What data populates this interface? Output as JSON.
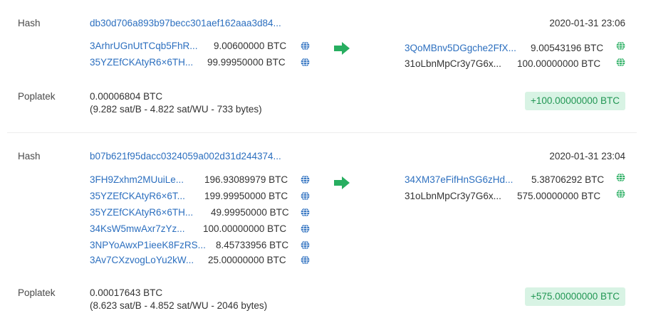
{
  "labels": {
    "hash": "Hash",
    "fee": "Poplatek"
  },
  "colors": {
    "link": "#2c6fbf",
    "green": "#219653",
    "badge_bg": "#d8f3e4",
    "globe_blue": "#2c6fbf",
    "globe_green": "#27ae60"
  },
  "transactions": [
    {
      "hash": "db30d706a893b97becc301aef162aaa3d84...",
      "time": "2020-01-31 23:06",
      "inputs": [
        {
          "address": "3ArhrUGnUtTCqb5FhR...",
          "amount": "9.00600000 BTC"
        },
        {
          "address": "35YZEfCKAtyR6×6TH...",
          "amount": "99.99950000 BTC"
        }
      ],
      "outputs": [
        {
          "address": "3QoMBnv5DGgche2FfX...",
          "amount": "9.00543196 BTC",
          "link": true
        },
        {
          "address": "31oLbnMpCr3y7G6x...",
          "amount": "100.00000000 BTC",
          "link": false
        }
      ],
      "fee": "0.00006804 BTC",
      "fee_detail": "(9.282 sat/B - 4.822 sat/WU - 733 bytes)",
      "badge": "+100.00000000 BTC"
    },
    {
      "hash": "b07b621f95dacc0324059a002d31d244374...",
      "time": "2020-01-31 23:04",
      "inputs": [
        {
          "address": "3FH9Zxhm2MUuiLe...",
          "amount": "196.93089979 BTC"
        },
        {
          "address": "35YZEfCKAtyR6×6T...",
          "amount": "199.99950000 BTC"
        },
        {
          "address": "35YZEfCKAtyR6×6TH...",
          "amount": "49.99950000 BTC"
        },
        {
          "address": "34KsW5mwAxr7zYz...",
          "amount": "100.00000000 BTC"
        },
        {
          "address": "3NPYoAwxP1ieeK8FzRS...",
          "amount": "8.45733956 BTC"
        },
        {
          "address": "3Av7CXzvogLoYu2kW...",
          "amount": "25.00000000 BTC"
        }
      ],
      "outputs": [
        {
          "address": "34XM37eFifHnSG6zHd...",
          "amount": "5.38706292 BTC",
          "link": true
        },
        {
          "address": "31oLbnMpCr3y7G6x...",
          "amount": "575.00000000 BTC",
          "link": false
        }
      ],
      "fee": "0.00017643 BTC",
      "fee_detail": "(8.623 sat/B - 4.852 sat/WU - 2046 bytes)",
      "badge": "+575.00000000 BTC"
    }
  ]
}
